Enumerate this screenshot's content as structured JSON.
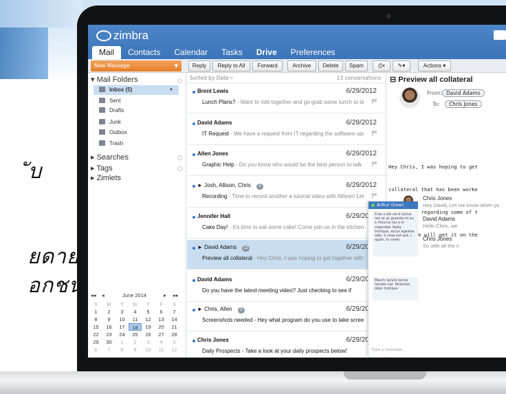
{
  "app": {
    "logo": "zimbra"
  },
  "tabs": [
    "Mail",
    "Contacts",
    "Calendar",
    "Tasks",
    "Drive",
    "Preferences"
  ],
  "toolbar": {
    "new_message": "New Message",
    "reply": "Reply",
    "reply_all": "Reply to All",
    "forward": "Forward",
    "archive": "Archive",
    "delete": "Delete",
    "spam": "Spam",
    "actions": "Actions"
  },
  "folders": {
    "header": "Mail Folders",
    "items": [
      {
        "label": "Inbox (5)",
        "icon": "inbox-icon"
      },
      {
        "label": "Sent",
        "icon": "sent-icon"
      },
      {
        "label": "Drafts",
        "icon": "drafts-icon"
      },
      {
        "label": "Junk",
        "icon": "junk-icon"
      },
      {
        "label": "Outbox",
        "icon": "outbox-icon"
      },
      {
        "label": "Trash",
        "icon": "trash-icon"
      }
    ],
    "searches": "Searches",
    "tags": "Tags",
    "zimlets": "Zimlets"
  },
  "calendar": {
    "month": "June 2014",
    "weekdays": [
      "S",
      "M",
      "T",
      "W",
      "T",
      "F",
      "S"
    ],
    "weeks": [
      [
        "1",
        "2",
        "3",
        "4",
        "5",
        "6",
        "7"
      ],
      [
        "8",
        "9",
        "10",
        "11",
        "12",
        "13",
        "14"
      ],
      [
        "15",
        "16",
        "17",
        "18",
        "19",
        "20",
        "21"
      ],
      [
        "22",
        "23",
        "24",
        "25",
        "26",
        "27",
        "28"
      ],
      [
        "29",
        "30",
        "1",
        "2",
        "3",
        "4",
        "5"
      ],
      [
        "6",
        "7",
        "8",
        "9",
        "10",
        "11",
        "12"
      ]
    ],
    "today": "18"
  },
  "list": {
    "sort": "Sorted by Date",
    "count": "13 conversations",
    "messages": [
      {
        "from": "Brent Lewis",
        "date": "6/29/2012",
        "subject": "Lunch Plans?",
        "preview": "Want to ride together and go grab some lunch to talk"
      },
      {
        "from": "David Adams",
        "date": "6/29/2012",
        "subject": "IT Request",
        "preview": "We have a request from IT regarding the software upda"
      },
      {
        "from": "Allen Jones",
        "date": "6/29/2012",
        "subject": "Graphic Help",
        "preview": "Do you know who would be the best person to talk t"
      },
      {
        "from": "► Josh, Allison, Chris",
        "badge": "3",
        "date": "6/29/2012",
        "subject": "Recording",
        "preview": "Time to record another a tutorial video with Allison! Let"
      },
      {
        "from": "Jennifer Hall",
        "date": "6/29/2012",
        "subject": "Cake Day!",
        "preview": "It's time to eat some cake! Come join us in the kitchen a"
      },
      {
        "from": "► David Adams",
        "badge": "12",
        "date": "6/29/2012",
        "subject": "Preview all collateral",
        "preview": "Hey Chris, I was hoping to get together with"
      },
      {
        "from": "David Adams",
        "date": "6/29/2012",
        "subject": "",
        "preview": "Do you have the latest meeting video? Just checking to see if"
      },
      {
        "from": "► Chris, Allen",
        "badge": "3",
        "date": "6/29/2012",
        "subject": "",
        "preview": "Screenshots needed - Hey what program do you use to take screensh"
      },
      {
        "from": "Chris Jones",
        "date": "6/29/2012",
        "subject": "",
        "preview": "Daily Prospects - Take a look at your daily prospects below!"
      }
    ]
  },
  "reading": {
    "title": "Preview all collateral",
    "from_label": "From:",
    "from": "David Adams",
    "to_label": "To:",
    "to": "Chris Jones",
    "body": [
      "Hey Chris, I was hoping to get",
      "collateral that has been worke",
      "some input regarding some of t",
      "time and we will get it on the"
    ],
    "thread": [
      {
        "name": "Chris Jones",
        "snippet": "Hey David, Let me know when yo"
      },
      {
        "name": "David Adams",
        "snippet": "Hello Chris, we"
      },
      {
        "name": "Chris Jones",
        "snippet": "So with all the n"
      }
    ]
  },
  "chat": {
    "name": "Arthur Green",
    "msg1": "Cras a elit vel d luctus nec at ac gravida mi eu e rhoncus leo a m imperdiet. Nulla tristique, accun egestas odio. S vitae est sed, c quam. In vener",
    "msg2": "Mauris iaculis lectus hendre nisl. Pellentes dolor tristique",
    "placeholder": "Type a message..."
  },
  "overlay": {
    "line1": "ับ",
    "line2": "ยดาย",
    "line3": "อกชน"
  }
}
